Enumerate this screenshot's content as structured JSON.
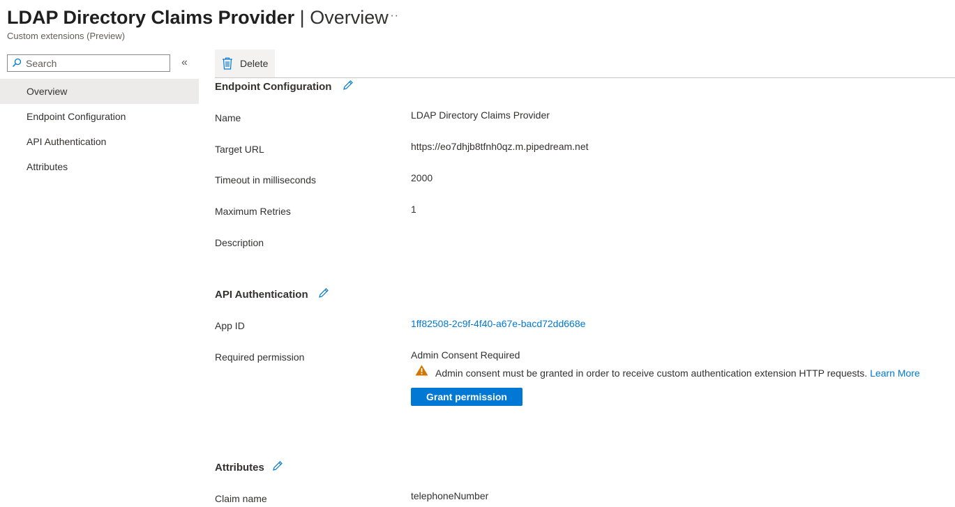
{
  "header": {
    "title": "LDAP Directory Claims Provider",
    "separator": "|",
    "section": "Overview",
    "more": "···",
    "subtitle": "Custom extensions (Preview)"
  },
  "sidebar": {
    "search_placeholder": "Search",
    "collapse": "«",
    "items": [
      {
        "label": "Overview",
        "active": true
      },
      {
        "label": "Endpoint Configuration"
      },
      {
        "label": "API Authentication"
      },
      {
        "label": "Attributes"
      }
    ]
  },
  "toolbar": {
    "delete_label": "Delete"
  },
  "endpoint": {
    "title": "Endpoint Configuration",
    "fields": [
      {
        "label": "Name",
        "value": "LDAP Directory Claims Provider"
      },
      {
        "label": "Target URL",
        "value": "https://eo7dhjb8tfnh0qz.m.pipedream.net"
      },
      {
        "label": "Timeout in milliseconds",
        "value": "2000"
      },
      {
        "label": "Maximum Retries",
        "value": "1"
      },
      {
        "label": "Description",
        "value": ""
      }
    ]
  },
  "api_auth": {
    "title": "API Authentication",
    "app_id_label": "App ID",
    "app_id": "1ff82508-2c9f-4f40-a67e-bacd72dd668e",
    "permission_label": "Required permission",
    "permission_value": "Admin Consent Required",
    "warning_text": "Admin consent must be granted in order to receive custom authentication extension HTTP requests.",
    "learn_more": "Learn More",
    "grant_button": "Grant permission"
  },
  "attributes": {
    "title": "Attributes",
    "claim_label": "Claim name",
    "claim_value": "telephoneNumber"
  },
  "colors": {
    "accent": "#0078d4",
    "warning": "#d47500",
    "selected_nav": "#edebe9"
  }
}
